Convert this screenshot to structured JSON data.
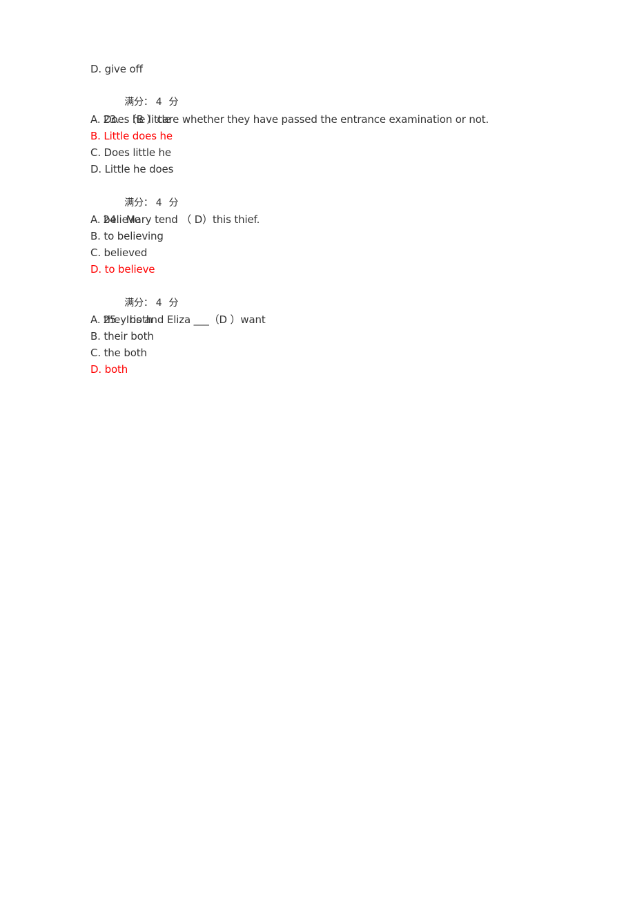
{
  "document": {
    "score_label": "满分：",
    "score_value": "4",
    "score_unit": "分",
    "prev_question_tail": {
      "option_d": "D. give off"
    },
    "questions": [
      {
        "number": "23.",
        "stem": "（B ）care whether they have passed the entrance examination or not.",
        "answer": "B",
        "options": [
          {
            "text": "A. Does he little",
            "correct": false
          },
          {
            "text": "B. Little does he",
            "correct": true
          },
          {
            "text": "C. Does little he",
            "correct": false
          },
          {
            "text": "D. Little he does",
            "correct": false
          }
        ]
      },
      {
        "number": "24.",
        "stem": "Mary tend （ D）this thief.",
        "answer": "D",
        "options": [
          {
            "text": "A. believe",
            "correct": false
          },
          {
            "text": "B. to believing",
            "correct": false
          },
          {
            "text": "C. believed",
            "correct": false
          },
          {
            "text": "D. to believe",
            "correct": true
          }
        ]
      },
      {
        "number": "25.",
        "stem": "Iris and Eliza ___（D ）want",
        "answer": "D",
        "options": [
          {
            "text": "A. they both",
            "correct": false
          },
          {
            "text": "B. their both",
            "correct": false
          },
          {
            "text": "C. the both",
            "correct": false
          },
          {
            "text": "D. both",
            "correct": true
          }
        ]
      }
    ]
  },
  "colors": {
    "text": "#333333",
    "correct_answer": "#ff0000",
    "background": "#ffffff"
  }
}
